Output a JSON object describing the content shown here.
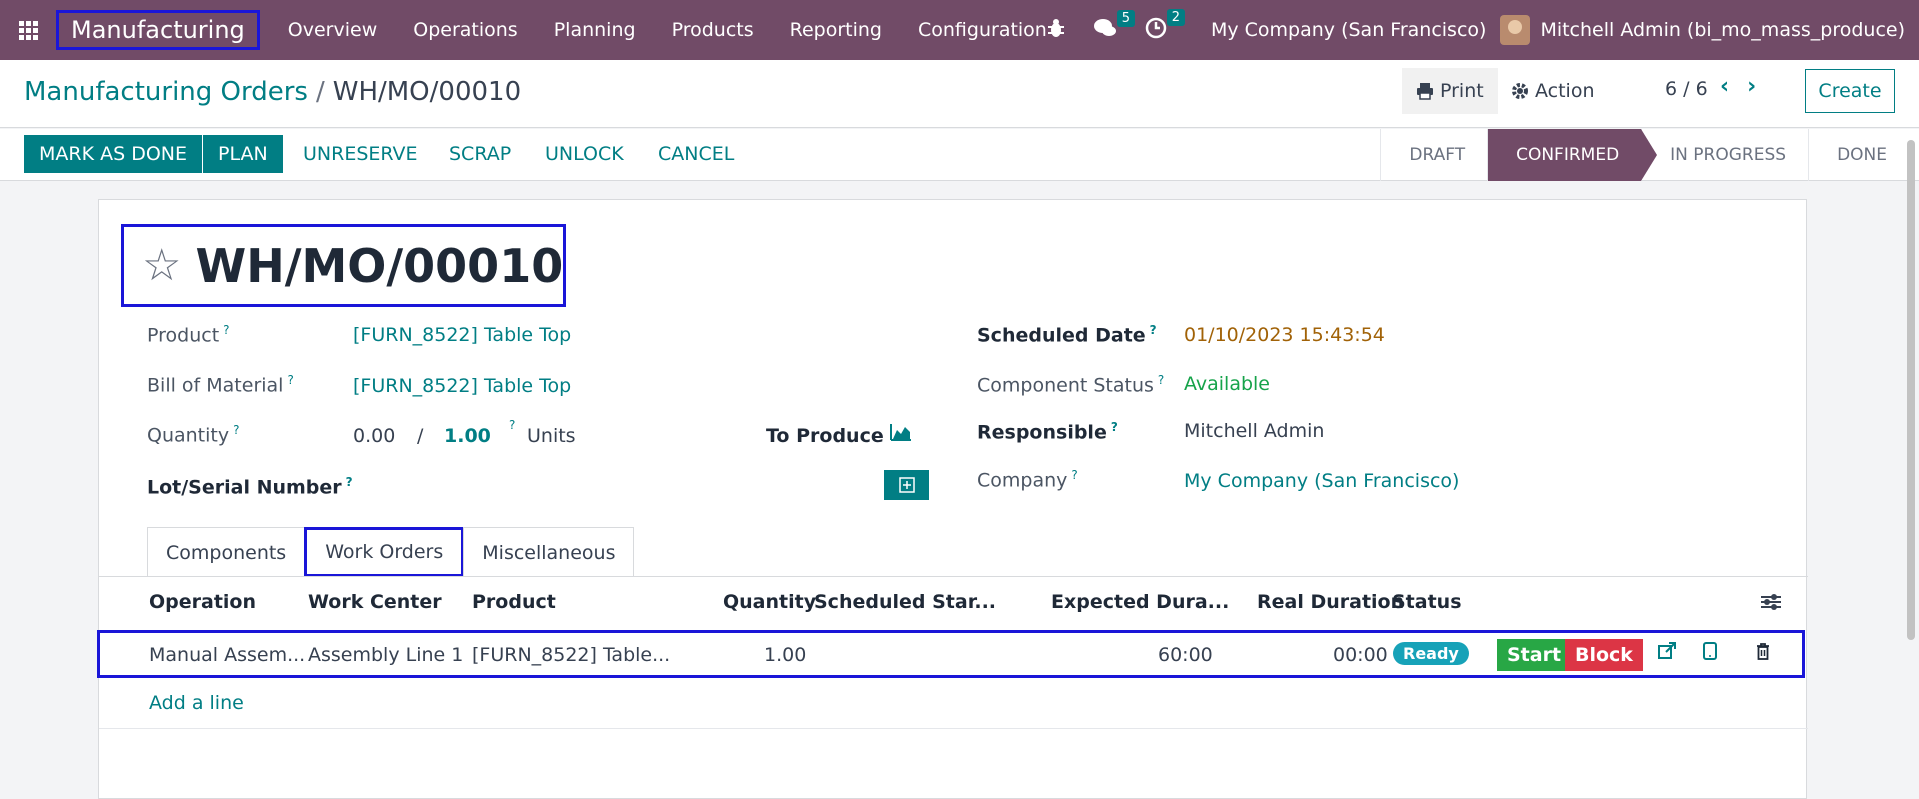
{
  "navbar": {
    "app_name": "Manufacturing",
    "menu": [
      "Overview",
      "Operations",
      "Planning",
      "Products",
      "Reporting",
      "Configuration"
    ],
    "messages_count": "5",
    "activities_count": "2",
    "company": "My Company (San Francisco)",
    "user": "Mitchell Admin (bi_mo_mass_produce)"
  },
  "control": {
    "breadcrumb_parent": "Manufacturing Orders",
    "breadcrumb_sep": "/",
    "breadcrumb_current": "WH/MO/00010",
    "print_label": "Print",
    "action_label": "Action",
    "pager": "6 / 6",
    "create_label": "Create"
  },
  "statusbar": {
    "buttons": [
      "MARK AS DONE",
      "PLAN",
      "UNRESERVE",
      "SCRAP",
      "UNLOCK",
      "CANCEL"
    ],
    "stages": [
      "DRAFT",
      "CONFIRMED",
      "IN PROGRESS",
      "DONE"
    ],
    "active_stage": "CONFIRMED"
  },
  "form": {
    "title": "WH/MO/00010",
    "product_label": "Product",
    "product_value": "[FURN_8522] Table Top",
    "bom_label": "Bill of Material",
    "bom_value": "[FURN_8522] Table Top",
    "quantity_label": "Quantity",
    "qty_produced": "0.00",
    "qty_sep": "/",
    "qty_total": "1.00",
    "uom": "Units",
    "to_produce_label": "To Produce",
    "lot_label": "Lot/Serial Number",
    "scheduled_label": "Scheduled Date",
    "scheduled_value": "01/10/2023 15:43:54",
    "component_status_label": "Component Status",
    "component_status_value": "Available",
    "responsible_label": "Responsible",
    "responsible_value": "Mitchell Admin",
    "company_label": "Company",
    "company_value": "My Company (San Francisco)",
    "help_mark": "?"
  },
  "tabs": [
    "Components",
    "Work Orders",
    "Miscellaneous"
  ],
  "workorders": {
    "columns": [
      "Operation",
      "Work Center",
      "Product",
      "Quantity",
      "Scheduled Star...",
      "Expected Dura...",
      "Real Duration",
      "Status"
    ],
    "rows": [
      {
        "operation": "Manual Assem...",
        "work_center": "Assembly Line 1",
        "product": "[FURN_8522] Table...",
        "quantity": "1.00",
        "expected": "60:00",
        "real": "00:00",
        "status": "Ready",
        "start_label": "Start",
        "block_label": "Block"
      }
    ],
    "add_line": "Add a line"
  },
  "colors": {
    "brand": "#714b67",
    "primary": "#017e84",
    "start": "#28a745",
    "block": "#dc3545",
    "ready": "#17a2b8"
  }
}
